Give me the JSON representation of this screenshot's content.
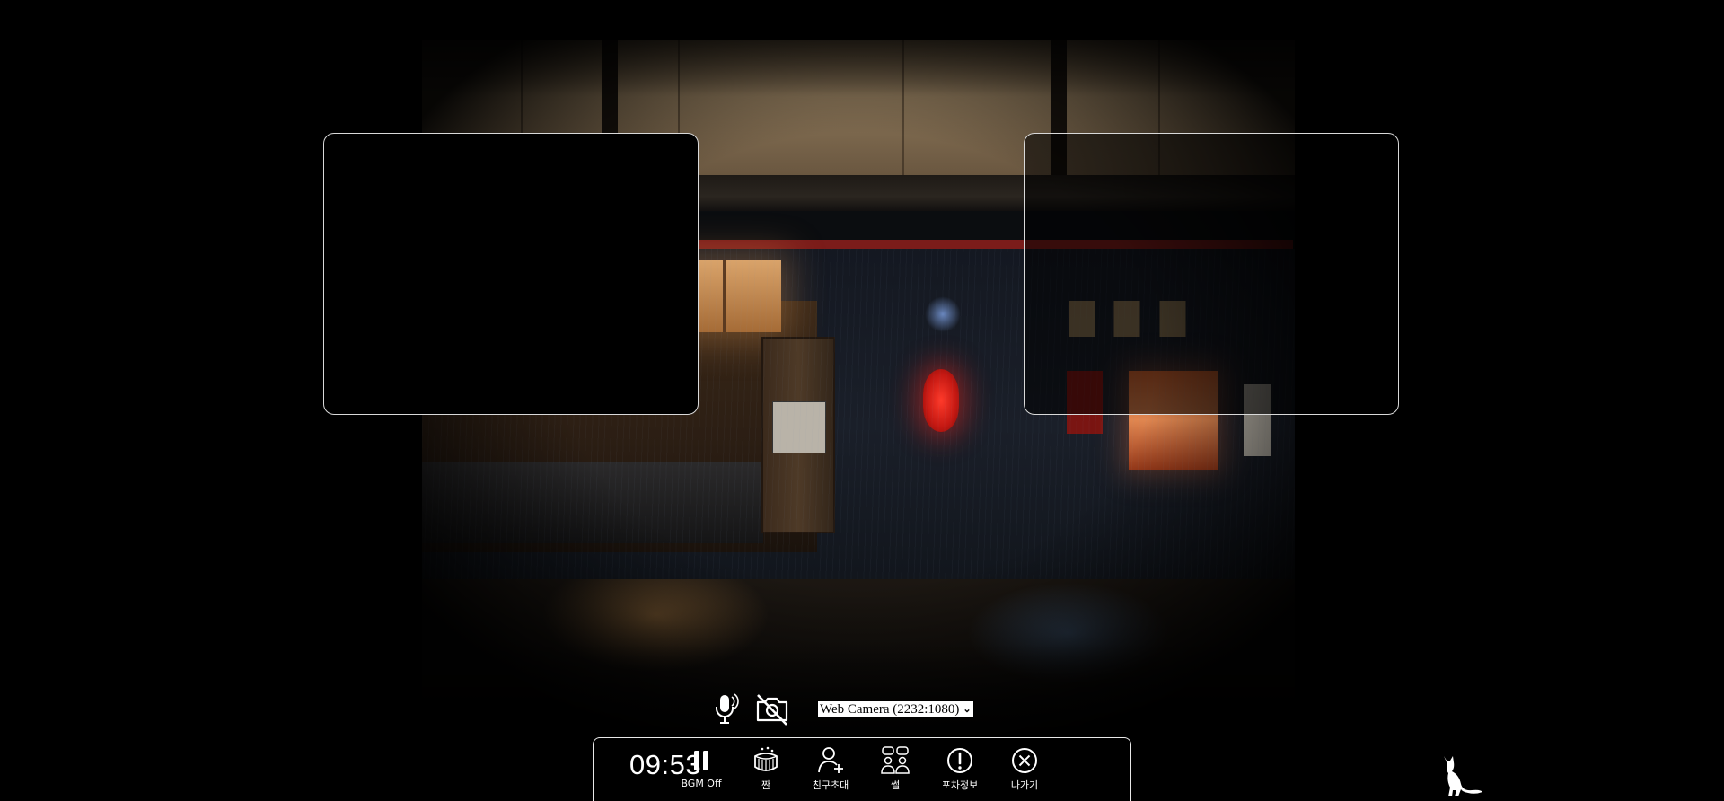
{
  "media": {
    "camera_select_value": "Web Camera (2232:1080)"
  },
  "toolbar": {
    "clock": "09:53",
    "items": [
      {
        "label": "BGM Off",
        "icon": "pause-icon"
      },
      {
        "label": "짠",
        "icon": "cheers-icon"
      },
      {
        "label": "친구초대",
        "icon": "add-friend-icon"
      },
      {
        "label": "썰",
        "icon": "chat-people-icon"
      },
      {
        "label": "포차정보",
        "icon": "info-icon"
      },
      {
        "label": "나가기",
        "icon": "close-circle-icon"
      }
    ]
  },
  "colors": {
    "background": "#000000",
    "tile_border": "#d9d9d9",
    "toolbar_border": "#e8e8e8",
    "text": "#ffffff"
  }
}
